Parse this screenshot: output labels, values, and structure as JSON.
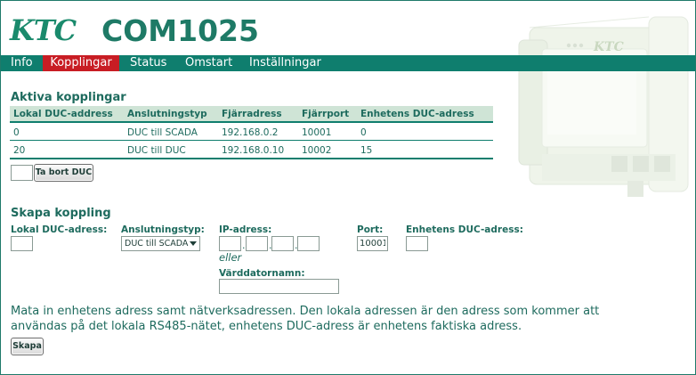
{
  "header": {
    "logo_text": "KTC",
    "title": "COM1025"
  },
  "nav": {
    "items": [
      {
        "label": "Info",
        "active": false
      },
      {
        "label": "Kopplingar",
        "active": true
      },
      {
        "label": "Status",
        "active": false
      },
      {
        "label": "Omstart",
        "active": false
      },
      {
        "label": "Inställningar",
        "active": false
      }
    ]
  },
  "active_connections": {
    "title": "Aktiva kopplingar",
    "columns": [
      "Lokal DUC-address",
      "Anslutningstyp",
      "Fjärradress",
      "Fjärrport",
      "Enhetens DUC-adress"
    ],
    "rows": [
      [
        "0",
        "DUC till SCADA",
        "192.168.0.2",
        "10001",
        "0"
      ],
      [
        "20",
        "DUC till DUC",
        "192.168.0.10",
        "10002",
        "15"
      ]
    ],
    "remove_input_value": "",
    "remove_button_label": "Ta bort DUC"
  },
  "create_connection": {
    "title": "Skapa koppling",
    "local_duc_label": "Lokal DUC-adress:",
    "local_duc_value": "",
    "connection_type_label": "Anslutningstyp:",
    "connection_type_value": "DUC till SCADA",
    "ip_label": "IP-adress:",
    "ip_octets": [
      "",
      "",
      "",
      ""
    ],
    "ip_separator": ".",
    "or_text": "eller",
    "hostname_label": "Värddatornamn:",
    "hostname_value": "",
    "port_label": "Port:",
    "port_value": "10001",
    "device_duc_label": "Enhetens DUC-adress:",
    "device_duc_value": "",
    "info_text": "Mata in enhetens adress samt nätverksadressen. Den lokala adressen är den adress som kommer att användas på det lokala RS485-nätet, enhetens DUC-adress är enhetens faktiska adress.",
    "create_button_label": "Skapa"
  },
  "colors": {
    "accent": "#0f7e6e",
    "active_tab": "#c81d24",
    "text": "#1e6b5e",
    "table_header_bg": "#cfe4d6"
  },
  "device_illustration": {
    "brand_text": "KTC"
  }
}
